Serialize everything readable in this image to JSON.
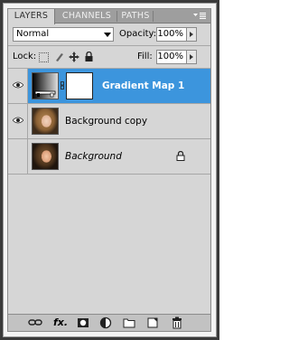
{
  "tabs": [
    {
      "label": "LAYERS",
      "active": true
    },
    {
      "label": "CHANNELS",
      "active": false
    },
    {
      "label": "PATHS",
      "active": false
    }
  ],
  "panel_menu_icon": "panel-menu-icon",
  "blend_mode": {
    "value": "Normal"
  },
  "opacity": {
    "label": "Opacity:",
    "value": "100%"
  },
  "lock": {
    "label": "Lock:",
    "icons": [
      "lock-transparent-pixels-icon",
      "lock-image-pixels-icon",
      "lock-position-icon",
      "lock-all-icon"
    ]
  },
  "fill": {
    "label": "Fill:",
    "value": "100%"
  },
  "layers": [
    {
      "name": "Gradient Map 1",
      "selected": true,
      "visible": true,
      "type": "adjustment",
      "italic": false
    },
    {
      "name": "Background copy",
      "selected": false,
      "visible": true,
      "type": "image",
      "italic": false
    },
    {
      "name": "Background",
      "selected": false,
      "visible": false,
      "type": "image",
      "italic": true,
      "locked": true
    }
  ],
  "bottom_icons": [
    "link-layers-icon",
    "add-layer-style-icon",
    "add-layer-mask-icon",
    "new-adjustment-layer-icon",
    "new-group-icon",
    "new-layer-icon",
    "delete-layer-icon"
  ],
  "colors": {
    "selection": "#3c95dd",
    "panel": "#d6d6d6",
    "tabbar": "#9e9e9e"
  }
}
